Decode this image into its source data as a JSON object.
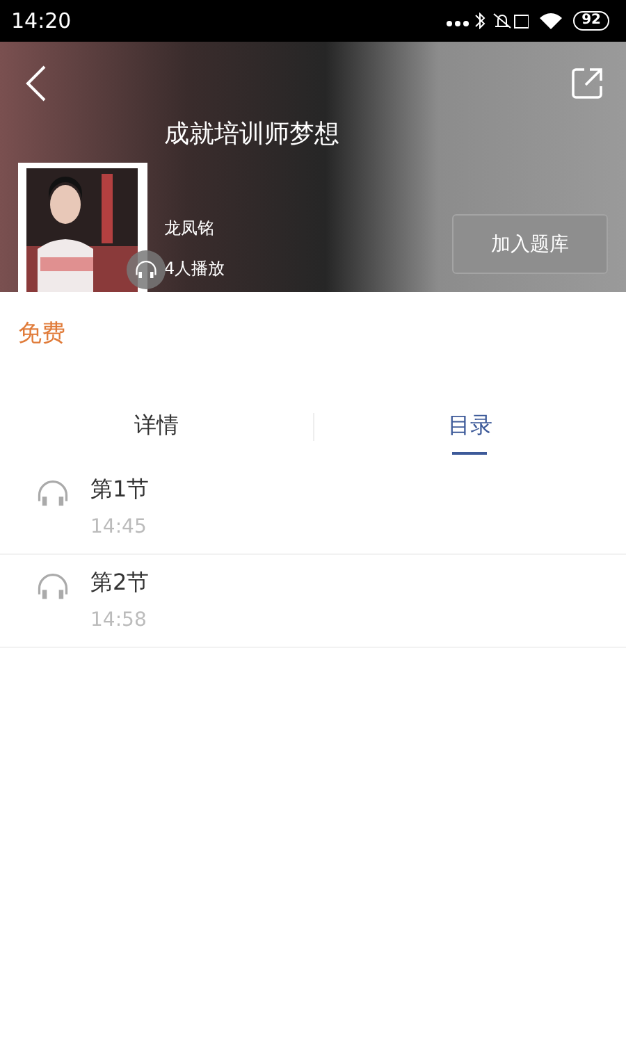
{
  "status_bar": {
    "time": "14:20",
    "battery": "92"
  },
  "header": {
    "title": "成就培训师梦想",
    "author": "龙凤铭",
    "plays": "4人播放",
    "add_button": "加入题库"
  },
  "price": "免费",
  "tabs": [
    {
      "label": "详情",
      "selected": false
    },
    {
      "label": "目录",
      "selected": true
    }
  ],
  "sections": [
    {
      "title": "第1节",
      "duration": "14:45"
    },
    {
      "title": "第2节",
      "duration": "14:58"
    }
  ]
}
